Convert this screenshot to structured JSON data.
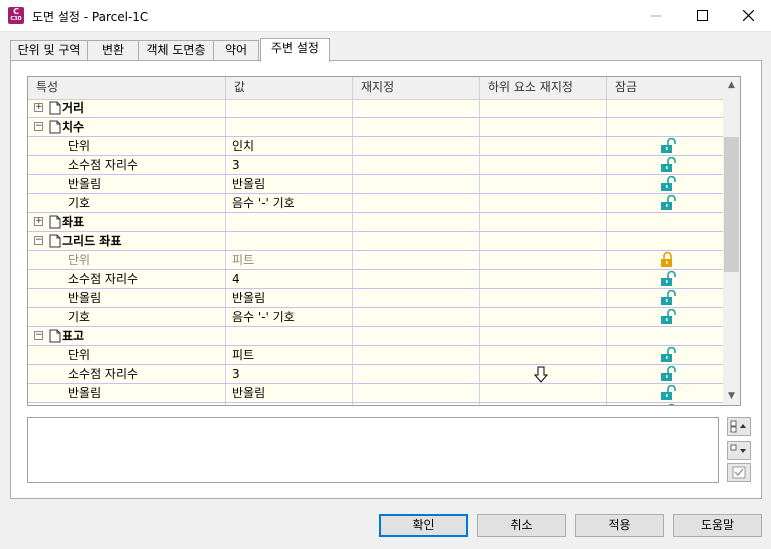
{
  "window": {
    "title": "도면 설정 - Parcel-1C",
    "icon_letter": "C",
    "icon_sub": "C3D"
  },
  "tabs": [
    {
      "label": "단위 및 구역",
      "active": false
    },
    {
      "label": "변환",
      "active": false
    },
    {
      "label": "객체 도면층",
      "active": false
    },
    {
      "label": "약어",
      "active": false
    },
    {
      "label": "주변 설정",
      "active": true
    }
  ],
  "grid": {
    "columns": [
      "특성",
      "값",
      "재지정",
      "하위 요소 재지정",
      "잠금"
    ],
    "rows": [
      {
        "type": "category",
        "label": "거리",
        "expander": "+"
      },
      {
        "type": "category",
        "label": "치수",
        "expander": "−"
      },
      {
        "type": "prop",
        "label": "단위",
        "value": "인치",
        "lock": "unlocked"
      },
      {
        "type": "prop",
        "label": "소수점 자리수",
        "value": "3",
        "lock": "unlocked"
      },
      {
        "type": "prop",
        "label": "반올림",
        "value": "반올림",
        "lock": "unlocked"
      },
      {
        "type": "prop",
        "label": "기호",
        "value": "음수 '-' 기호",
        "lock": "unlocked"
      },
      {
        "type": "category",
        "label": "좌표",
        "expander": "+"
      },
      {
        "type": "category",
        "label": "그리드 좌표",
        "expander": "−"
      },
      {
        "type": "prop",
        "label": "단위",
        "value": "피트",
        "lock": "locked",
        "dimmed": true
      },
      {
        "type": "prop",
        "label": "소수점 자리수",
        "value": "4",
        "lock": "unlocked"
      },
      {
        "type": "prop",
        "label": "반올림",
        "value": "반올림",
        "lock": "unlocked"
      },
      {
        "type": "prop",
        "label": "기호",
        "value": "음수 '-' 기호",
        "lock": "unlocked"
      },
      {
        "type": "category",
        "label": "표고",
        "expander": "−"
      },
      {
        "type": "prop",
        "label": "단위",
        "value": "피트",
        "lock": "unlocked"
      },
      {
        "type": "prop",
        "label": "소수점 자리수",
        "value": "3",
        "lock": "unlocked"
      },
      {
        "type": "prop",
        "label": "반올림",
        "value": "반올림",
        "lock": "unlocked"
      },
      {
        "type": "prop",
        "label": "",
        "value": "",
        "lock": "unlocked"
      }
    ]
  },
  "colors": {
    "lock_unlocked": "#1fa3a8",
    "lock_locked": "#e6a100",
    "row_bg": "#fffff0",
    "default_button_border": "#0078d7"
  },
  "buttons": {
    "ok": "확인",
    "cancel": "취소",
    "apply": "적용",
    "help": "도움말"
  }
}
